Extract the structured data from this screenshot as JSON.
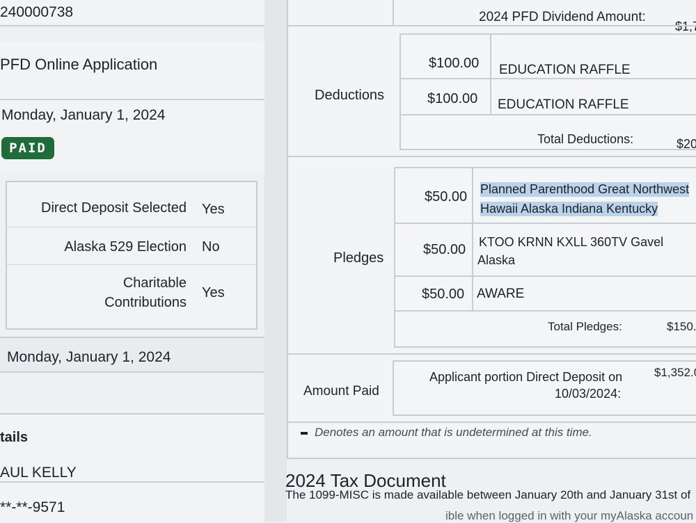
{
  "left": {
    "application_id": "240000738",
    "application_type": "PFD Online Application",
    "submitted_date": "Monday, January 1, 2024",
    "status_badge": "PAID",
    "elections": [
      {
        "label": "Direct Deposit Selected",
        "value": "Yes"
      },
      {
        "label": "Alaska 529 Election",
        "value": "No"
      },
      {
        "label_line1": "Charitable",
        "label_line2": "Contributions",
        "value": "Yes"
      }
    ],
    "status_date": "Monday, January 1, 2024",
    "details_heading": "tails",
    "applicant_name": "AUL KELLY",
    "ssn_masked": "**-**-9571"
  },
  "payment": {
    "dividend_label": "2024 PFD Dividend Amount:",
    "dividend_value": "$1,7",
    "deductions": {
      "label": "Deductions",
      "items": [
        {
          "amount": "$100.00",
          "description": "EDUCATION RAFFLE"
        },
        {
          "amount": "$100.00",
          "description": "EDUCATION RAFFLE"
        }
      ],
      "total_label": "Total Deductions:",
      "total_value": "$20"
    },
    "pledges": {
      "label": "Pledges",
      "items": [
        {
          "amount": "$50.00",
          "line1": "Planned Parenthood Great Northwest",
          "line2": "Hawaii Alaska Indiana Kentucky"
        },
        {
          "amount": "$50.00",
          "line1": "KTOO KRNN KXLL 360TV Gavel",
          "line2": "Alaska"
        },
        {
          "amount": "$50.00",
          "line1": "AWARE",
          "line2": ""
        }
      ],
      "total_label": "Total Pledges:",
      "total_value": "$150.0"
    },
    "amount_paid": {
      "label": "Amount Paid",
      "desc_line1": "Applicant portion Direct Deposit on",
      "desc_line2": "10/03/2024:",
      "value": "$1,352.0"
    },
    "note": "Denotes an amount that is undetermined at this time."
  },
  "tax": {
    "heading": "2024 Tax Document",
    "line1": "The 1099-MISC is made available between January 20th and January 31st of",
    "line2": "ible when logged in with your myAlaska accoun"
  },
  "colors": {
    "paid_badge": "#1f6b3a",
    "highlight": "#b9d3ea"
  }
}
